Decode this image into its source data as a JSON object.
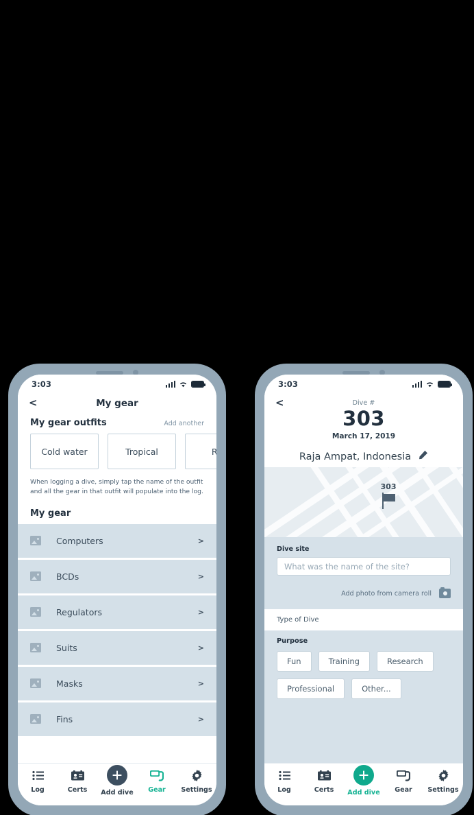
{
  "left_phone": {
    "status_bar": {
      "time": "3:03",
      "icons": [
        "signal-bars",
        "wifi",
        "battery"
      ]
    },
    "nav": {
      "back": "<",
      "title": "My gear"
    },
    "outfits_section": {
      "title": "My gear outfits",
      "add_link": "Add another",
      "chips": [
        "Cold water",
        "Tropical",
        "Res"
      ],
      "helper_text": "When logging a dive, simply tap the name of the outfit and all the gear in that outfit will populate into the log."
    },
    "mygear_section": {
      "title": "My gear",
      "items": [
        {
          "label": "Computers",
          "chevron": ">"
        },
        {
          "label": "BCDs",
          "chevron": ">"
        },
        {
          "label": "Regulators",
          "chevron": ">"
        },
        {
          "label": "Suits",
          "chevron": ">"
        },
        {
          "label": "Masks",
          "chevron": ">"
        },
        {
          "label": "Fins",
          "chevron": ">"
        }
      ]
    },
    "tabbar": {
      "active": "Gear",
      "tabs": [
        {
          "label": "Log",
          "icon": "list-icon"
        },
        {
          "label": "Certs",
          "icon": "id-card-icon"
        },
        {
          "label": "Add dive",
          "icon": "plus-circle-icon"
        },
        {
          "label": "Gear",
          "icon": "dive-mask-icon"
        },
        {
          "label": "Settings",
          "icon": "gear-icon"
        }
      ]
    }
  },
  "right_phone": {
    "status_bar": {
      "time": "3:03",
      "icons": [
        "signal-bars",
        "wifi",
        "battery"
      ]
    },
    "nav": {
      "back": "<"
    },
    "dive_header": {
      "kicker": "Dive #",
      "number": "303",
      "date": "March 17, 2019",
      "location": "Raja Ampat, Indonesia",
      "edit_icon": "pencil-icon"
    },
    "map": {
      "marker_label": "303",
      "marker_icon": "flag-icon"
    },
    "dive_site": {
      "label": "Dive site",
      "value": "",
      "placeholder": "What was the name of the site?",
      "photo_label": "Add photo from camera roll",
      "photo_icon": "camera-icon"
    },
    "type_of_dive": {
      "section_title": "Type of Dive",
      "purpose_label": "Purpose",
      "options": [
        "Fun",
        "Training",
        "Research",
        "Professional",
        "Other..."
      ]
    },
    "tabbar": {
      "active": "Add dive",
      "tabs": [
        {
          "label": "Log",
          "icon": "list-icon"
        },
        {
          "label": "Certs",
          "icon": "id-card-icon"
        },
        {
          "label": "Add dive",
          "icon": "plus-circle-icon"
        },
        {
          "label": "Gear",
          "icon": "dive-mask-icon"
        },
        {
          "label": "Settings",
          "icon": "gear-icon"
        }
      ]
    }
  },
  "colors": {
    "accent_teal": "#0fa98c",
    "dark_slate": "#3d4f60",
    "frame_gray": "#93a7b6",
    "row_bg": "#d4e0e8",
    "section_bg": "#d6e1e9",
    "background": "#000000"
  }
}
